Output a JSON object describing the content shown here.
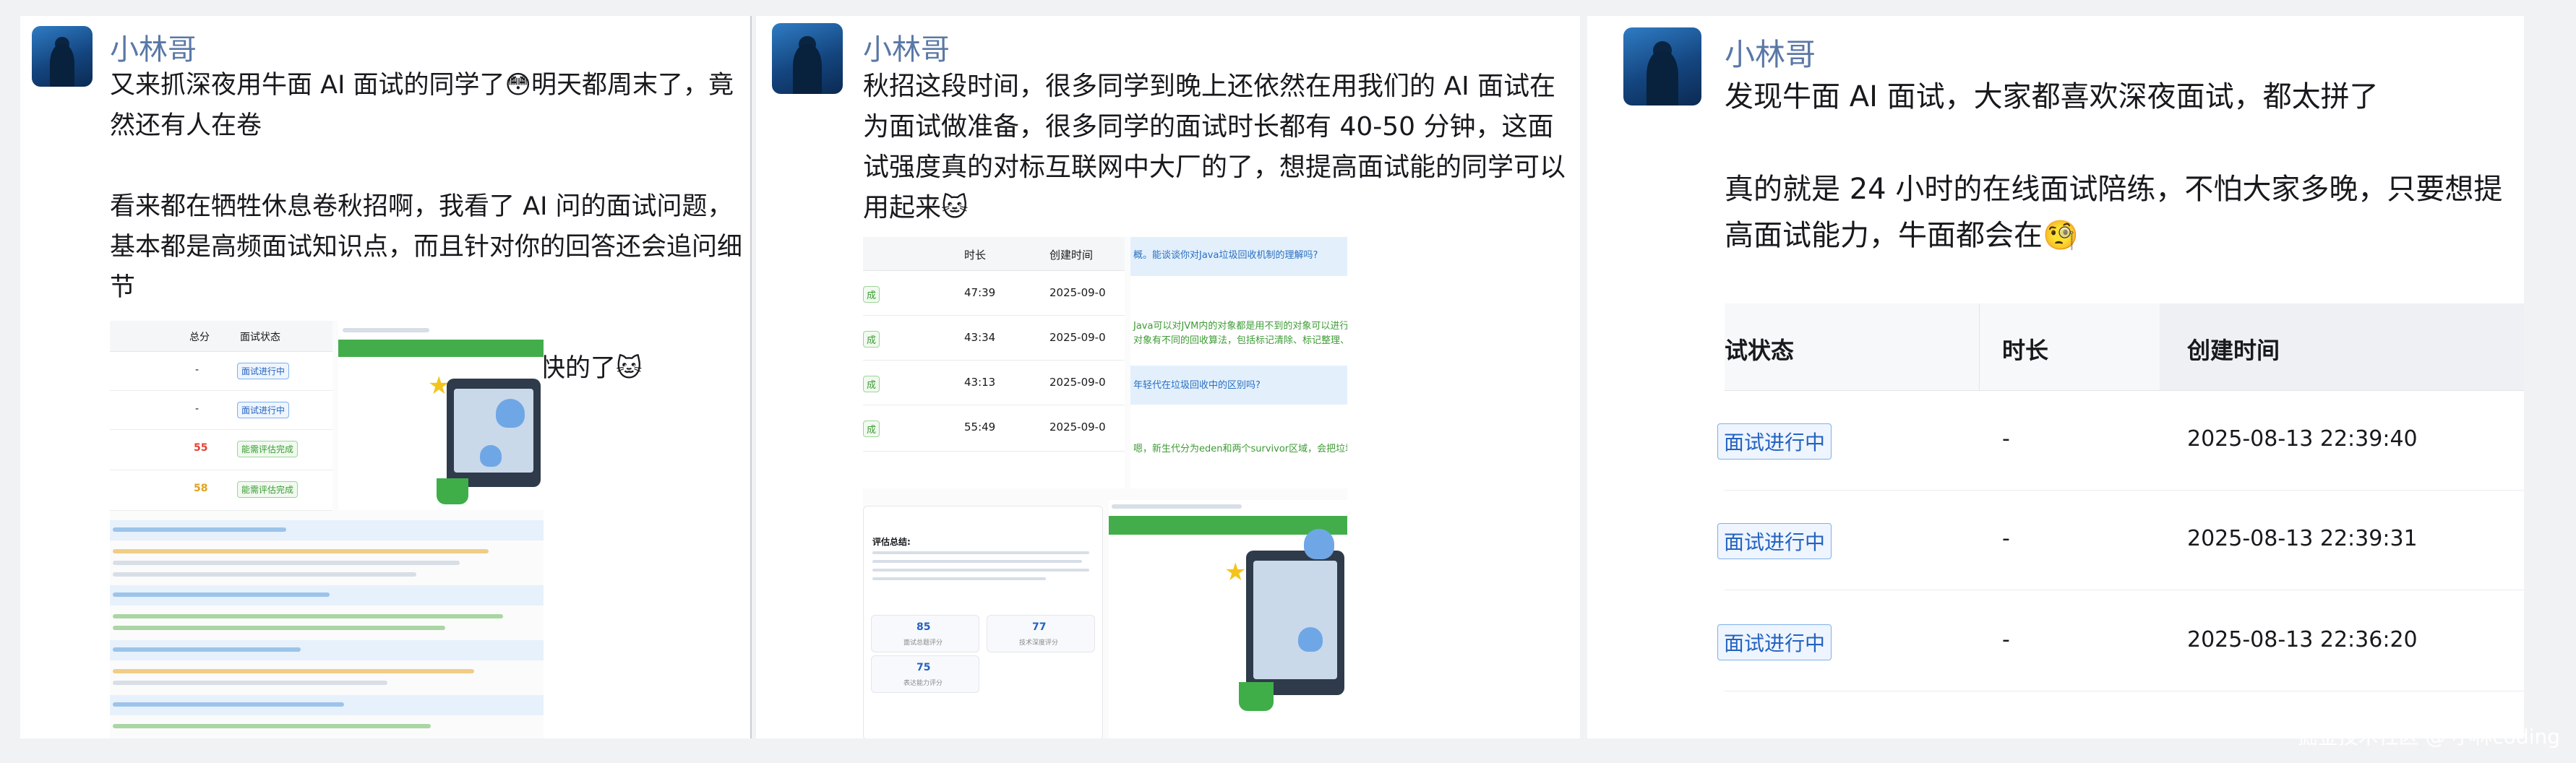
{
  "posts": [
    {
      "author": "小林哥",
      "paragraphs": [
        "又来抓深夜用牛面 AI 面试的同学了😳明天都周末了，竟然还有人在卷",
        "看来都在牺牲休息卷秋招啊，我看了 AI 问的面试问题，基本都是高频面试知识点，而且针对你的回答还会追问细节",
        "这个强度不低了，能看扛下来，进步飞快的了🐱"
      ],
      "table": {
        "headers": [
          "总分",
          "面试状态"
        ],
        "rows": [
          {
            "score": "-",
            "status": "面试进行中"
          },
          {
            "score": "-",
            "status": "面试进行中"
          },
          {
            "score": "55",
            "status": "能需评估完成"
          },
          {
            "score": "58",
            "status": "能需评估完成"
          }
        ]
      }
    },
    {
      "author": "小林哥",
      "paragraphs": [
        "秋招这段时间，很多同学到晚上还依然在用我们的 AI 面试在为面试做准备，很多同学的面试时长都有 40-50 分钟，这面试强度真的对标互联网中大厂的了，想提高面试能的同学可以用起来🐱"
      ],
      "table": {
        "headers": [
          "时长",
          "创建时间"
        ],
        "rows": [
          {
            "tag": "成",
            "duration": "47:39",
            "created": "2025-09-0"
          },
          {
            "tag": "成",
            "duration": "43:34",
            "created": "2025-09-0"
          },
          {
            "tag": "成",
            "duration": "43:13",
            "created": "2025-09-0"
          },
          {
            "tag": "成",
            "duration": "55:49",
            "created": "2025-09-0"
          }
        ]
      },
      "chat": [
        "概。能谈谈你对Java垃圾回收机制的理解吗?",
        "Java可以对JVM内的对象都是用不到的对象可以进行回收",
        "对象有不同的回收算法，包括标记清除、标记整理、标记复制",
        "年轻代在垃圾回收中的区别吗?",
        "嗯，新生代分为eden和两个survivor区域，会把垃圾回收"
      ],
      "summary": {
        "title": "评估总结:",
        "scores": [
          {
            "value": "85",
            "label": "面试总题评分"
          },
          {
            "value": "77",
            "label": "技术深度评分"
          },
          {
            "value": "75",
            "label": "表达能力评分"
          }
        ]
      }
    },
    {
      "author": "小林哥",
      "paragraphs": [
        "发现牛面 AI 面试，大家都喜欢深夜面试，都太拼了",
        "真的就是 24 小时的在线面试陪练，不怕大家多晚，只要想提高面试能力，牛面都会在🧐"
      ],
      "table": {
        "headers": [
          "试状态",
          "时长",
          "创建时间"
        ],
        "rows": [
          {
            "status": "面试进行中",
            "duration": "-",
            "created": "2025-08-13 22:39:40"
          },
          {
            "status": "面试进行中",
            "duration": "-",
            "created": "2025-08-13 22:39:31"
          },
          {
            "status": "面试进行中",
            "duration": "-",
            "created": "2025-08-13 22:36:20"
          }
        ]
      }
    }
  ],
  "watermark": "掘金技术社区 @ 小林coding",
  "colors": {
    "author": "#5a78a6",
    "tag_blue": "#2463c0",
    "score_red": "#e34234",
    "score_gold": "#e1a21d",
    "green": "#43ad4b"
  }
}
